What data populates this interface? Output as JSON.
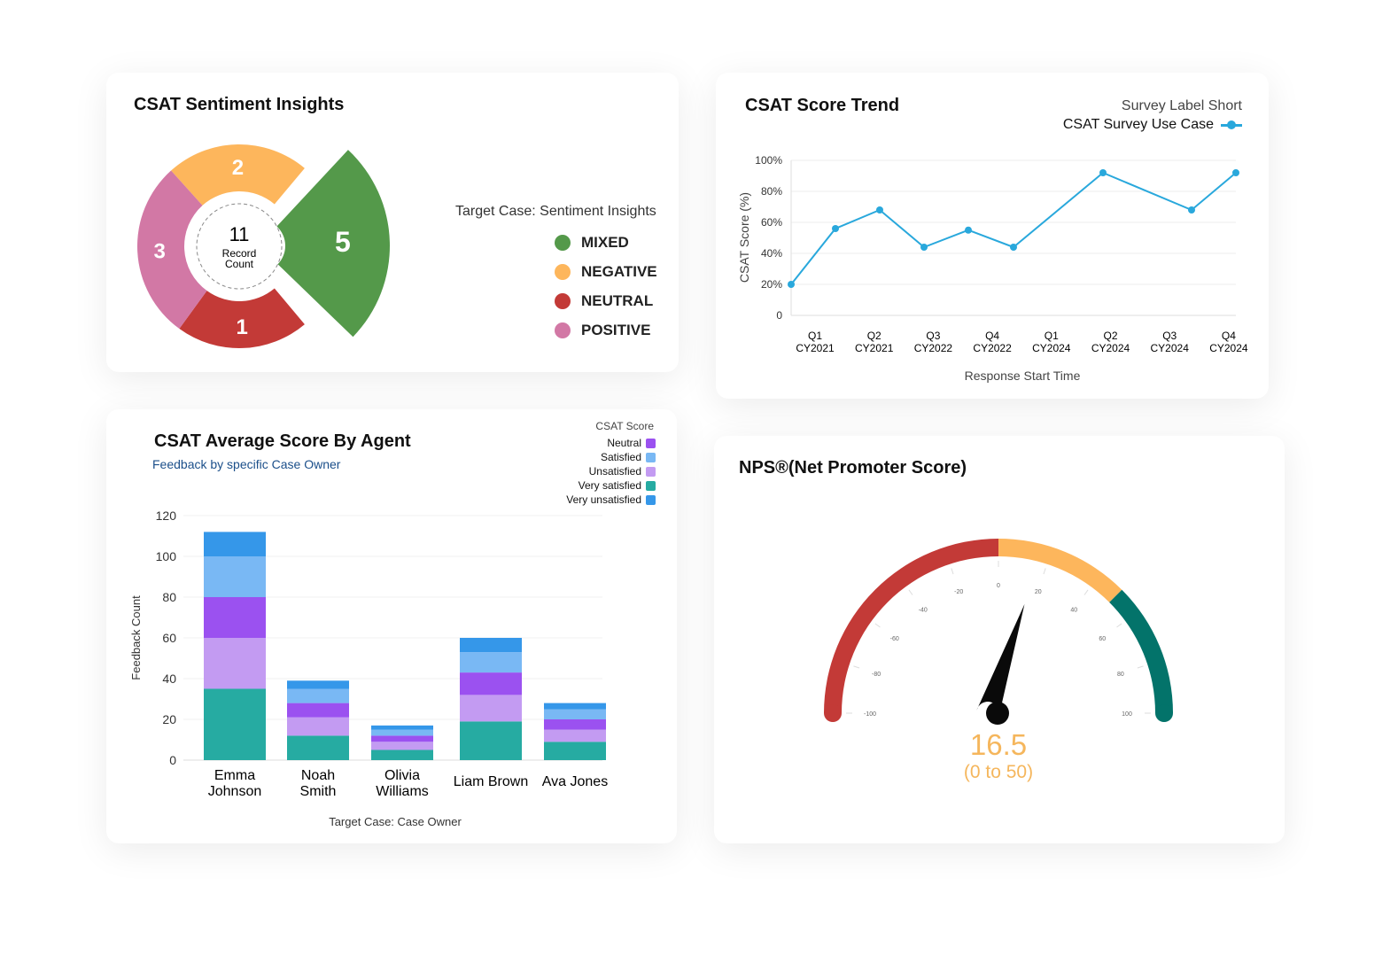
{
  "sentiment": {
    "title": "CSAT Sentiment Insights",
    "legend_title": "Target Case: Sentiment Insights",
    "center_value": "11",
    "center_label_1": "Record",
    "center_label_2": "Count",
    "chart_data": {
      "type": "pie",
      "subtype": "donut",
      "categories": [
        "MIXED",
        "NEGATIVE",
        "NEUTRAL",
        "POSITIVE"
      ],
      "values": [
        5,
        2,
        1,
        3
      ],
      "colors": [
        "#54994a",
        "#fdb65c",
        "#c33a37",
        "#d278a5"
      ],
      "total": 11,
      "legend": "right"
    }
  },
  "trend": {
    "title": "CSAT Score Trend",
    "legend_title": "Survey Label Short",
    "legend_series": "CSAT Survey Use Case",
    "chart_data": {
      "type": "line",
      "ylabel": "CSAT Score (%)",
      "xlabel": "Response Start Time",
      "yticks": [
        "0",
        "20%",
        "40%",
        "60%",
        "80%",
        "100%"
      ],
      "ylim": [
        0,
        100
      ],
      "xticks": [
        [
          "Q1",
          "CY2021"
        ],
        [
          "Q2",
          "CY2021"
        ],
        [
          "Q3",
          "CY2022"
        ],
        [
          "Q4",
          "CY2022"
        ],
        [
          "Q1",
          "CY2024"
        ],
        [
          "Q2",
          "CY2024"
        ],
        [
          "Q3",
          "CY2024"
        ],
        [
          "Q4",
          "CY2024"
        ]
      ],
      "series": [
        {
          "name": "CSAT Survey Use Case",
          "values": [
            20,
            56,
            68,
            44,
            55,
            44,
            92,
            68,
            92
          ],
          "color": "#29a8dc"
        }
      ],
      "grid": true,
      "legend": "top-right"
    }
  },
  "agents": {
    "title": "CSAT Average Score By Agent",
    "subtitle": "Feedback by specific Case Owner",
    "legend_title": "CSAT Score",
    "legend": [
      {
        "name": "Neutral",
        "color": "#9b51f0"
      },
      {
        "name": "Satisfied",
        "color": "#79b8f4"
      },
      {
        "name": "Unsatisfied",
        "color": "#c39bf2"
      },
      {
        "name": "Very satisfied",
        "color": "#26aba2"
      },
      {
        "name": "Very unsatisfied",
        "color": "#3597e9"
      }
    ],
    "chart_data": {
      "type": "bar",
      "stacked": true,
      "ylabel": "Feedback Count",
      "xlabel": "Target Case: Case Owner",
      "ylim": [
        0,
        120
      ],
      "yticks": [
        "0",
        "20",
        "40",
        "60",
        "80",
        "100",
        "120"
      ],
      "categories": [
        [
          "Emma",
          "Johnson"
        ],
        [
          "Noah",
          "Smith"
        ],
        [
          "Olivia",
          "Williams"
        ],
        [
          "Liam Brown"
        ],
        [
          "Ava Jones"
        ]
      ],
      "series": [
        {
          "name": "Very satisfied",
          "color": "#26aba2",
          "values": [
            35,
            12,
            5,
            19,
            9
          ]
        },
        {
          "name": "Unsatisfied",
          "color": "#c39bf2",
          "values": [
            25,
            9,
            4,
            13,
            6
          ]
        },
        {
          "name": "Neutral",
          "color": "#9b51f0",
          "values": [
            20,
            7,
            3,
            11,
            5
          ]
        },
        {
          "name": "Satisfied",
          "color": "#79b8f4",
          "values": [
            20,
            7,
            3,
            10,
            5
          ]
        },
        {
          "name": "Very unsatisfied",
          "color": "#3597e9",
          "values": [
            12,
            4,
            2,
            7,
            3
          ]
        }
      ],
      "grid": true,
      "legend": "top-right"
    }
  },
  "nps": {
    "title": "NPS®(Net Promoter Score)",
    "value": "16.5",
    "range_label": "(0 to 50)",
    "chart_data": {
      "type": "gauge",
      "min": -100,
      "max": 100,
      "value": 16.5,
      "ticks": [
        "-100",
        "-80",
        "-60",
        "-40",
        "-20",
        "0",
        "20",
        "40",
        "60",
        "80",
        "100"
      ],
      "bands": [
        {
          "from": -100,
          "to": 0,
          "color": "#c33a37"
        },
        {
          "from": 0,
          "to": 50,
          "color": "#fdb65c"
        },
        {
          "from": 50,
          "to": 100,
          "color": "#03736a"
        }
      ]
    }
  }
}
